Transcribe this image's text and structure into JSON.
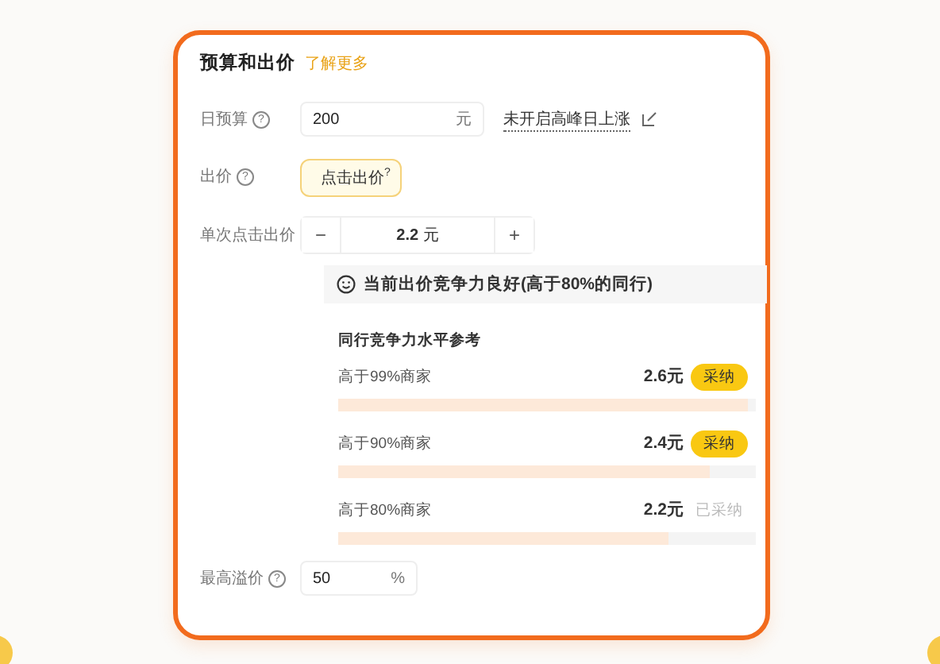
{
  "card": {
    "title": "预算和出价",
    "link": "了解更多"
  },
  "budget": {
    "label": "日预算",
    "help": "?",
    "value": "200",
    "unit": "元",
    "peak_link": "未开启高峰日上涨"
  },
  "bid": {
    "label": "出价",
    "help": "?",
    "button": "点击出价",
    "button_help": "?"
  },
  "cpc": {
    "label": "单次点击出价",
    "minus": "−",
    "value": "2.2",
    "unit": "元",
    "plus": "+"
  },
  "status": {
    "text": "当前出价竞争力良好(高于80%的同行)"
  },
  "reference": {
    "title": "同行竞争力水平参考",
    "items": [
      {
        "label": "高于99%商家",
        "price": "2.6元",
        "action": "采纳",
        "adopted": false,
        "level": 0.98
      },
      {
        "label": "高于90%商家",
        "price": "2.4元",
        "action": "采纳",
        "adopted": false,
        "level": 0.89
      },
      {
        "label": "高于80%商家",
        "price": "2.2元",
        "action": "已采纳",
        "adopted": true,
        "level": 0.79
      }
    ]
  },
  "premium": {
    "label": "最高溢价",
    "help": "?",
    "value": "50",
    "unit": "%"
  }
}
